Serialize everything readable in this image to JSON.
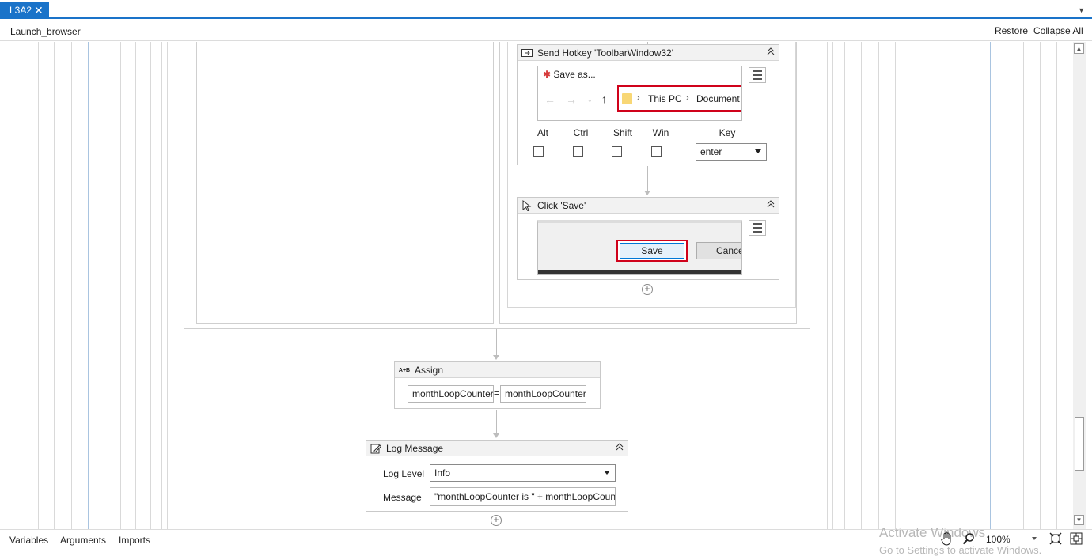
{
  "tab": {
    "label": "L3A2",
    "close": "✕"
  },
  "breadcrumb": "Launch_browser",
  "header_actions": {
    "restore": "Restore",
    "collapse_all": "Collapse All"
  },
  "send_hotkey": {
    "title": "Send Hotkey 'ToolbarWindow32'",
    "preview_title": "Save as...",
    "preview_path": [
      "This PC",
      "Document"
    ],
    "modifiers": [
      "Alt",
      "Ctrl",
      "Shift",
      "Win"
    ],
    "modifier_checked": [
      false,
      false,
      false,
      false
    ],
    "key_label": "Key",
    "key_value": "enter"
  },
  "click_save": {
    "title": "Click 'Save'",
    "preview_save": "Save",
    "preview_cancel": "Cance"
  },
  "assign": {
    "title": "Assign",
    "icon_text": "A+B",
    "to": "monthLoopCounter",
    "equals": "=",
    "value": "monthLoopCounter"
  },
  "log_message": {
    "title": "Log Message",
    "level_label": "Log Level",
    "level_value": "Info",
    "message_label": "Message",
    "message_value": "\"monthLoopCounter is \" + monthLoopCounter.ToString"
  },
  "bottom_tabs": [
    "Variables",
    "Arguments",
    "Imports"
  ],
  "watermark": {
    "line1": "Activate Windows",
    "line2": "Go to Settings to activate Windows."
  },
  "zoom": "100%",
  "icons": {
    "collapse": "chevron-double-up-icon",
    "hotkey": "keyboard-icon",
    "click": "mouse-cursor-icon",
    "log": "pencil-note-icon"
  },
  "colors": {
    "accent": "#1a73c9",
    "selection_red": "#d0021b",
    "folder": "#f8d775"
  }
}
